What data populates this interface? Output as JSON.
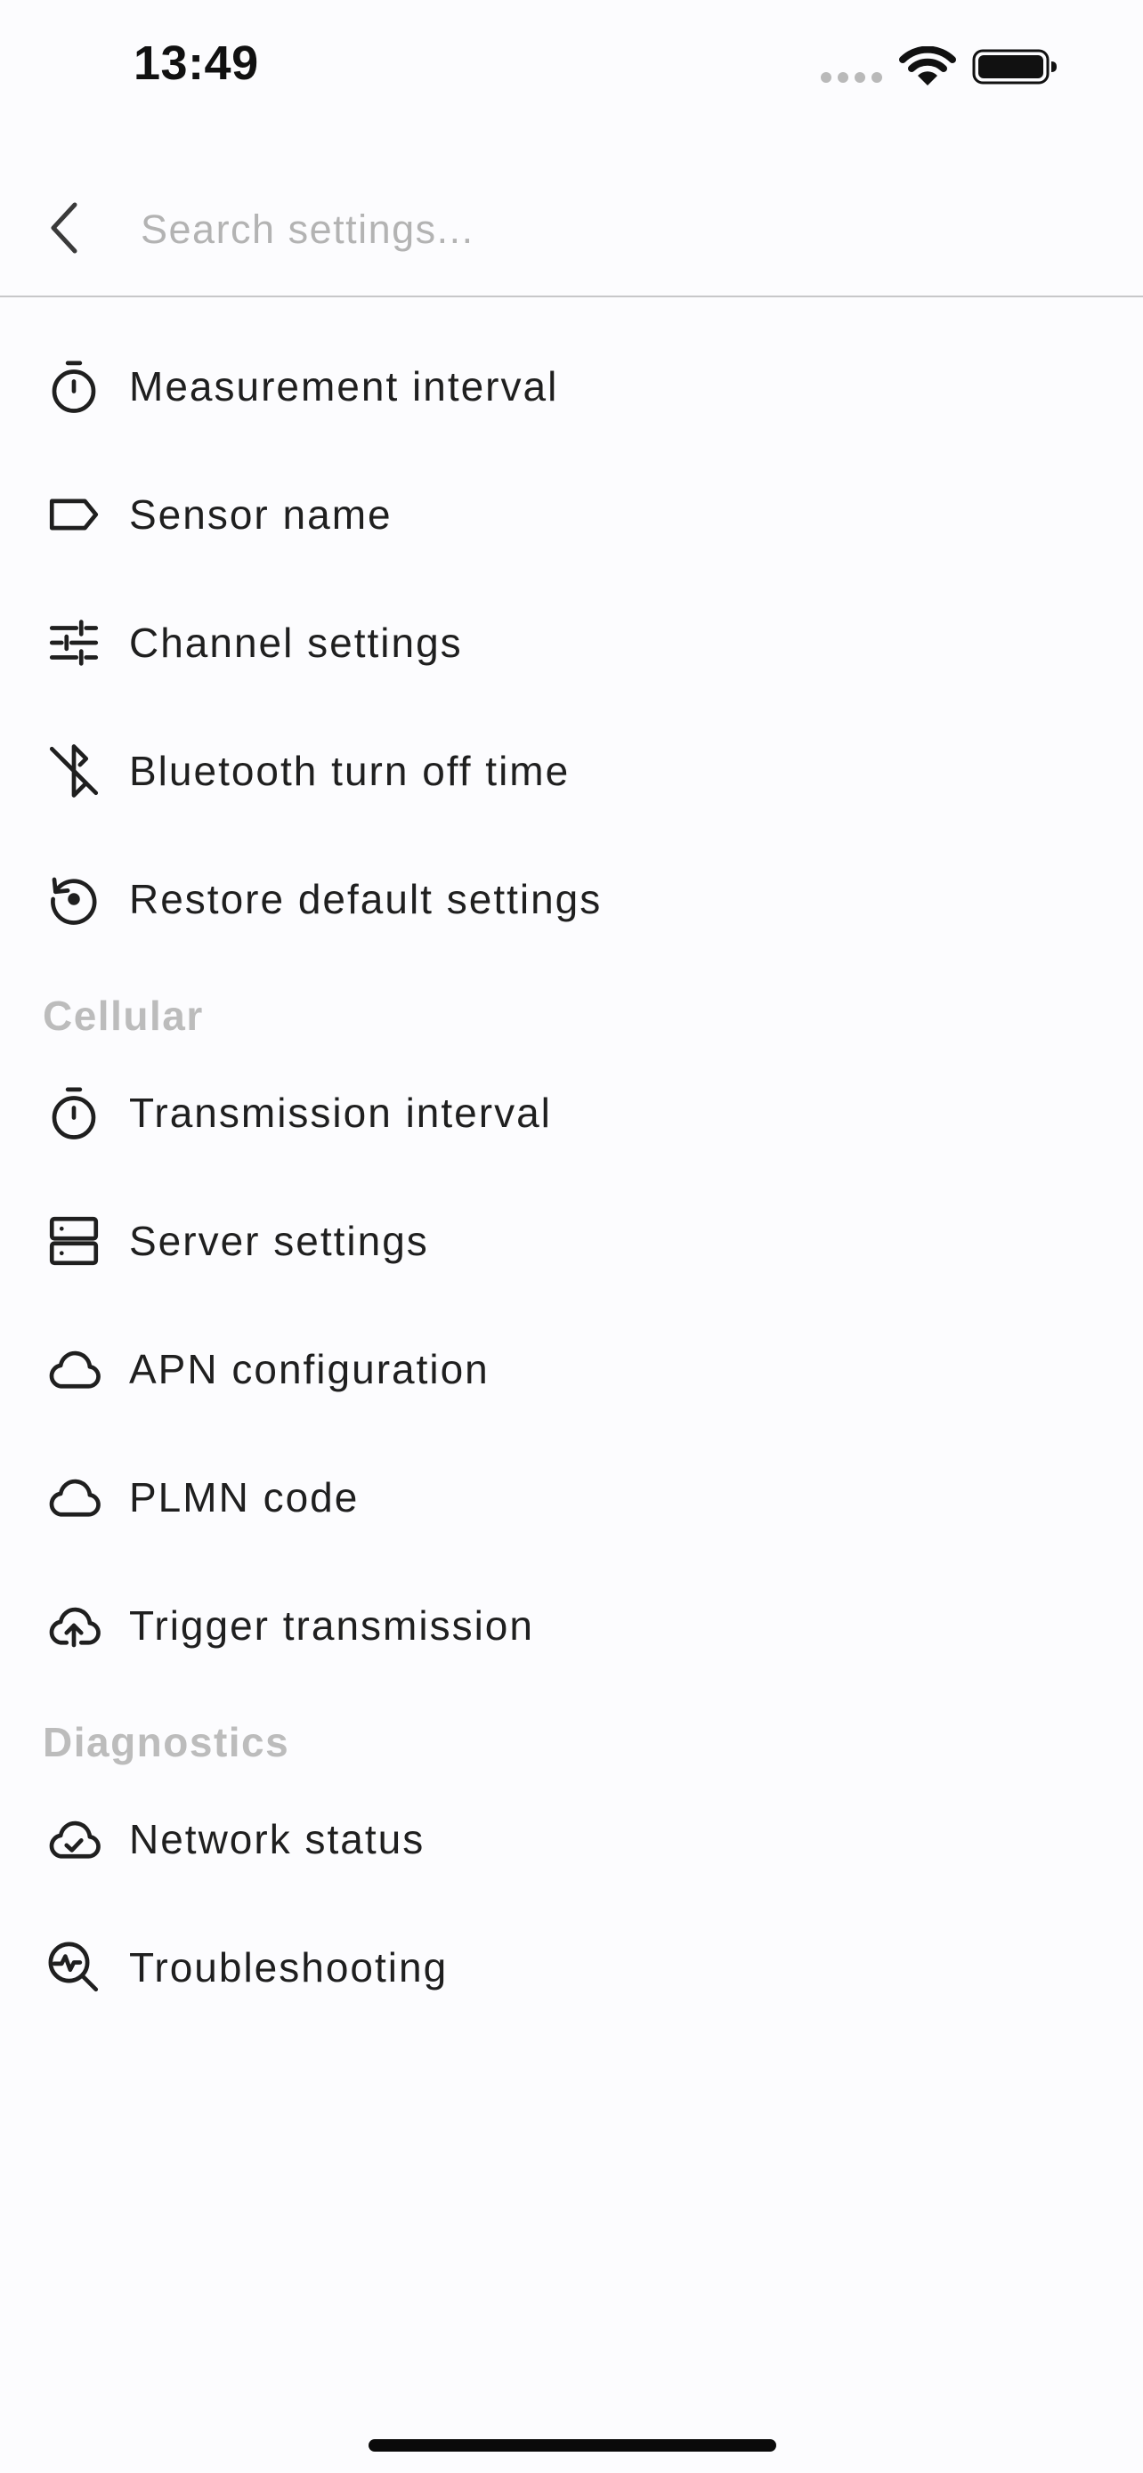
{
  "status_bar": {
    "time": "13:49"
  },
  "search": {
    "placeholder": "Search settings..."
  },
  "groups": [
    {
      "header": "",
      "items": [
        {
          "label": "Measurement interval",
          "icon": "timer-icon"
        },
        {
          "label": "Sensor name",
          "icon": "label-tag-icon"
        },
        {
          "label": "Channel settings",
          "icon": "sliders-icon"
        },
        {
          "label": "Bluetooth turn off time",
          "icon": "bluetooth-off-icon"
        },
        {
          "label": "Restore default settings",
          "icon": "restore-icon"
        }
      ]
    },
    {
      "header": "Cellular",
      "items": [
        {
          "label": "Transmission interval",
          "icon": "timer-icon"
        },
        {
          "label": "Server settings",
          "icon": "server-icon"
        },
        {
          "label": "APN configuration",
          "icon": "cloud-icon"
        },
        {
          "label": "PLMN code",
          "icon": "cloud-icon"
        },
        {
          "label": "Trigger transmission",
          "icon": "cloud-upload-icon"
        }
      ]
    },
    {
      "header": "Diagnostics",
      "items": [
        {
          "label": "Network status",
          "icon": "cloud-check-icon"
        },
        {
          "label": "Troubleshooting",
          "icon": "search-activity-icon"
        }
      ]
    }
  ],
  "colors": {
    "background": "#FCFCFE",
    "text": "#1F1F1F",
    "section_header": "#BCBCBC",
    "placeholder": "#B3B3B3",
    "divider": "#C7C7C9"
  }
}
